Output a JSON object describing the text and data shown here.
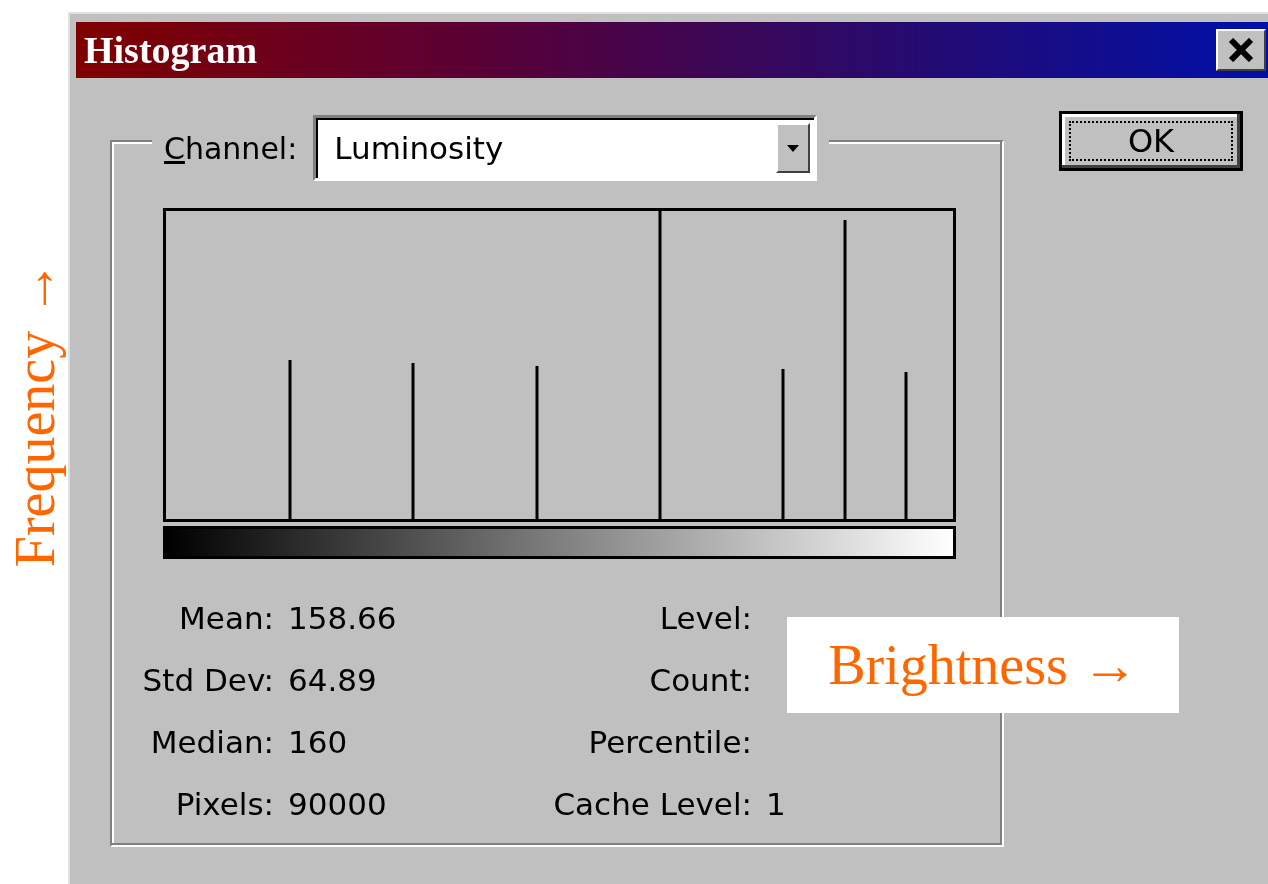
{
  "window": {
    "title": "Histogram"
  },
  "channel": {
    "label": "Channel:",
    "value": "Luminosity"
  },
  "ok_button": "OK",
  "stats_left": [
    {
      "label": "Mean:",
      "value": "158.66"
    },
    {
      "label": "Std Dev:",
      "value": "64.89"
    },
    {
      "label": "Median:",
      "value": "160"
    },
    {
      "label": "Pixels:",
      "value": "90000"
    }
  ],
  "stats_right": [
    {
      "label": "Level:"
    },
    {
      "label": "Count:"
    },
    {
      "label": "Percentile:"
    },
    {
      "label": "Cache Level:",
      "value": "1"
    }
  ],
  "annotations": {
    "y_axis": "Frequency →",
    "x_axis": "Brightness →"
  }
}
